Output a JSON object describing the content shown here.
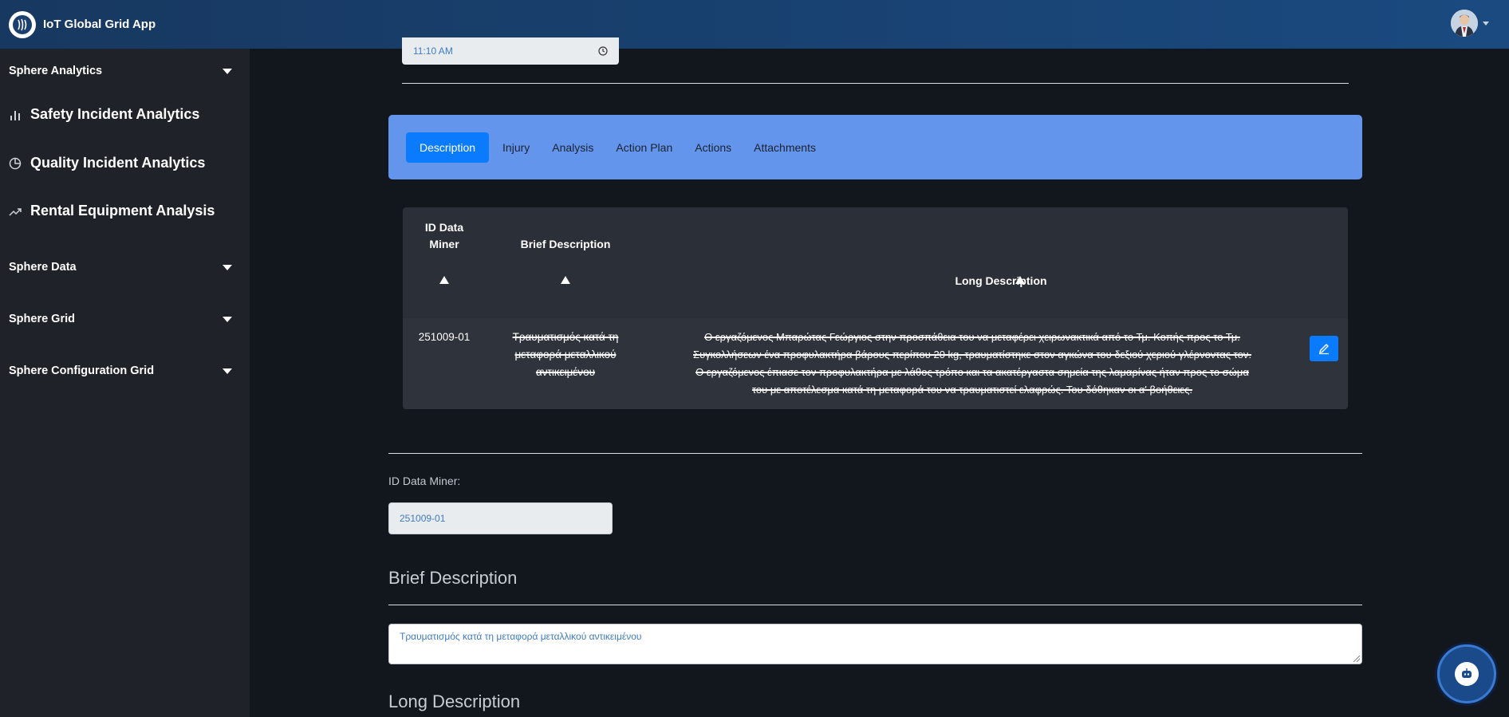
{
  "app": {
    "title": "IoT Global Grid App"
  },
  "header": {
    "logo_icon": "globe-logo-icon",
    "user_avatar": "user-avatar-icon"
  },
  "sidebar": {
    "groups": [
      {
        "label": "Sphere Analytics"
      },
      {
        "label": "Sphere Data"
      },
      {
        "label": "Sphere Grid"
      },
      {
        "label": "Sphere Configuration Grid"
      }
    ],
    "items": [
      {
        "label": "Safety Incident Analytics",
        "icon": "bar-chart-icon"
      },
      {
        "label": "Quality Incident Analytics",
        "icon": "pie-chart-icon"
      },
      {
        "label": "Rental Equipment Analysis",
        "icon": "trend-line-icon"
      }
    ]
  },
  "time_field": {
    "value": "11:10 AM",
    "icon": "clock-icon"
  },
  "tabs": [
    {
      "label": "Description",
      "active": true
    },
    {
      "label": "Injury"
    },
    {
      "label": "Analysis"
    },
    {
      "label": "Action Plan"
    },
    {
      "label": "Actions"
    },
    {
      "label": "Attachments"
    }
  ],
  "table": {
    "headers": {
      "id_line1": "ID Data",
      "id_line2": "Miner",
      "brief": "Brief Description",
      "long": "Long Description"
    },
    "rows": [
      {
        "id": "251009-01",
        "brief_lines": [
          "Τραυματισμός κατά τη",
          "μεταφορά μεταλλικού",
          "αντικειμένου"
        ],
        "long_lines": [
          "Ο εργαζόμενος Μπαρώτας Γεώργιος στην προσπάθεια του να μεταφέρει χειρωνακτικά από το Τμ. Κοπής προς το Τμ.",
          "Συγκολλήσεων ένα προφυλακτήρα βάρους περίπου 20 kg, τραυματίστηκε στον αγκώνα του δεξιού χεριού γλέρνοντας τον.",
          "Ο εργαζόμενος έπιασε τον προφυλακτήρα με λάθος τρόπο και τα ακατέργαστα σημεία της λαμαρίνας ήταν προς το σώμα",
          "του με αποτέλεσμα κατά τη μεταφορά του να τραυματιστεί ελαφρώς. Του δόθηκαν οι α' βοήθειες."
        ]
      }
    ],
    "edit_icon": "pencil-icon"
  },
  "form": {
    "id_label": "ID Data Miner:",
    "id_value": "251009-01",
    "brief_title": "Brief Description",
    "brief_value": "Τραυματισμός κατά τη μεταφορά μεταλλικού αντικειμένου",
    "long_title": "Long Description"
  },
  "chat": {
    "icon": "chatbot-icon"
  }
}
